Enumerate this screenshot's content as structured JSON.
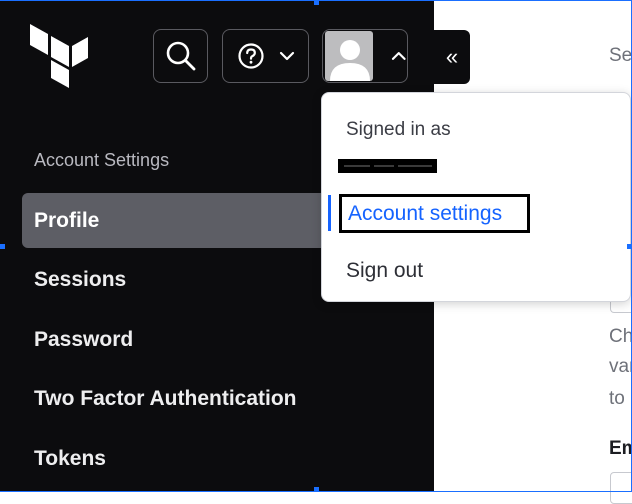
{
  "header": {
    "search_icon": "search-icon",
    "help_icon": "help-icon",
    "help_chevron_icon": "chevron-down-icon",
    "user_chevron_icon": "chevron-up-icon",
    "collapse_label": "«"
  },
  "sidebar": {
    "section_label": "Account Settings",
    "items": [
      {
        "label": "Profile",
        "active": true
      },
      {
        "label": "Sessions",
        "active": false
      },
      {
        "label": "Password",
        "active": false
      },
      {
        "label": "Two Factor Authentication",
        "active": false
      },
      {
        "label": "Tokens",
        "active": false
      }
    ]
  },
  "user_menu": {
    "signed_in_label": "Signed in as",
    "account_settings_label": "Account settings",
    "sign_out_label": "Sign out"
  },
  "main": {
    "partial_heading": "Set",
    "partial_lines": [
      "Ch",
      "var",
      "to"
    ],
    "partial_label": "Em"
  },
  "colors": {
    "sidebar_bg": "#0c0c0e",
    "active_item_bg": "#5d5e65",
    "link_blue": "#1563ff"
  }
}
